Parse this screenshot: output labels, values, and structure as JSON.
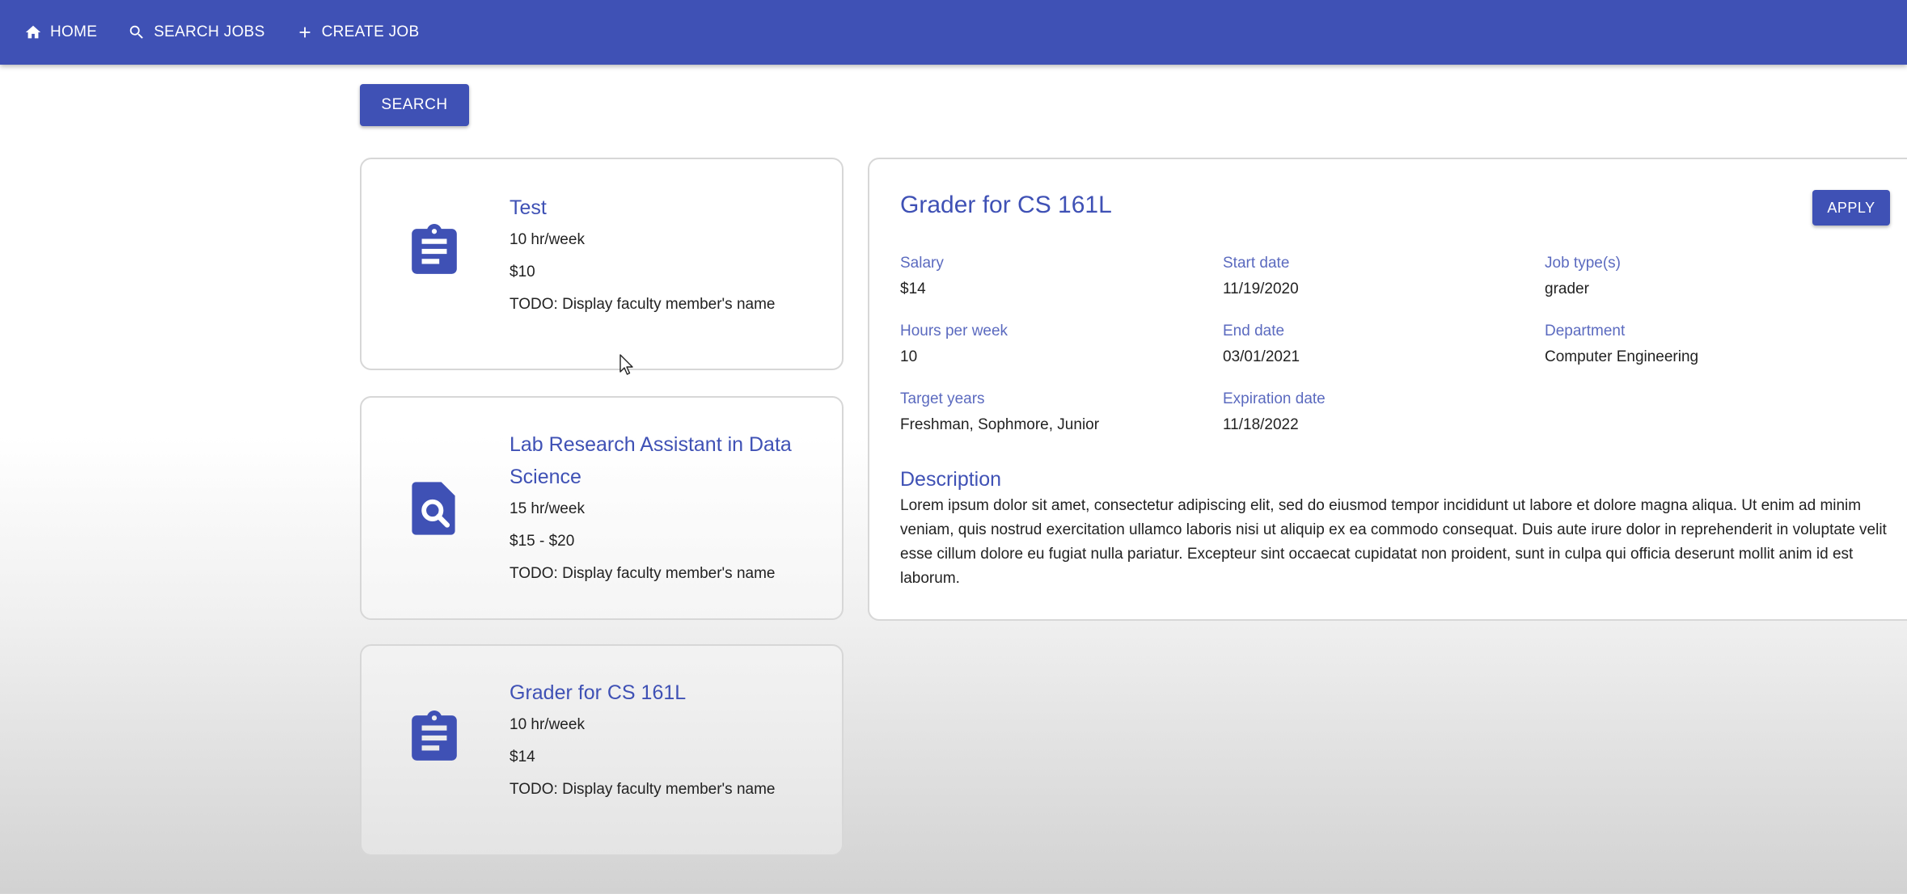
{
  "nav": {
    "home": "HOME",
    "search_jobs": "SEARCH JOBS",
    "create_job": "CREATE JOB"
  },
  "search_button": "SEARCH",
  "jobs": [
    {
      "title": "Test",
      "hours": "10 hr/week",
      "pay": "$10",
      "faculty": "TODO: Display faculty member's name",
      "icon": "clipboard-icon"
    },
    {
      "title": "Lab Research Assistant in Data Science",
      "hours": "15 hr/week",
      "pay": "$15 - $20",
      "faculty": "TODO: Display faculty member's name",
      "icon": "file-search-icon"
    },
    {
      "title": "Grader for CS 161L",
      "hours": "10 hr/week",
      "pay": "$14",
      "faculty": "TODO: Display faculty member's name",
      "icon": "clipboard-icon"
    }
  ],
  "detail": {
    "title": "Grader for CS 161L",
    "apply_label": "APPLY",
    "salary_label": "Salary",
    "salary": "$14",
    "start_date_label": "Start date",
    "start_date": "11/19/2020",
    "job_types_label": "Job type(s)",
    "job_types": "grader",
    "hours_label": "Hours per week",
    "hours": "10",
    "end_date_label": "End date",
    "end_date": "03/01/2021",
    "department_label": "Department",
    "department": "Computer Engineering",
    "target_years_label": "Target years",
    "target_years": "Freshman, Sophmore, Junior",
    "expiration_label": "Expiration date",
    "expiration": "11/18/2022",
    "description_label": "Description",
    "description": "Lorem ipsum dolor sit amet, consectetur adipiscing elit, sed do eiusmod tempor incididunt ut labore et dolore magna aliqua. Ut enim ad minim veniam, quis nostrud exercitation ullamco laboris nisi ut aliquip ex ea commodo consequat. Duis aute irure dolor in reprehenderit in voluptate velit esse cillum dolore eu fugiat nulla pariatur. Excepteur sint occaecat cupidatat non proident, sunt in culpa qui officia deserunt mollit anim id est laborum."
  },
  "colors": {
    "primary": "#3f51b5"
  }
}
